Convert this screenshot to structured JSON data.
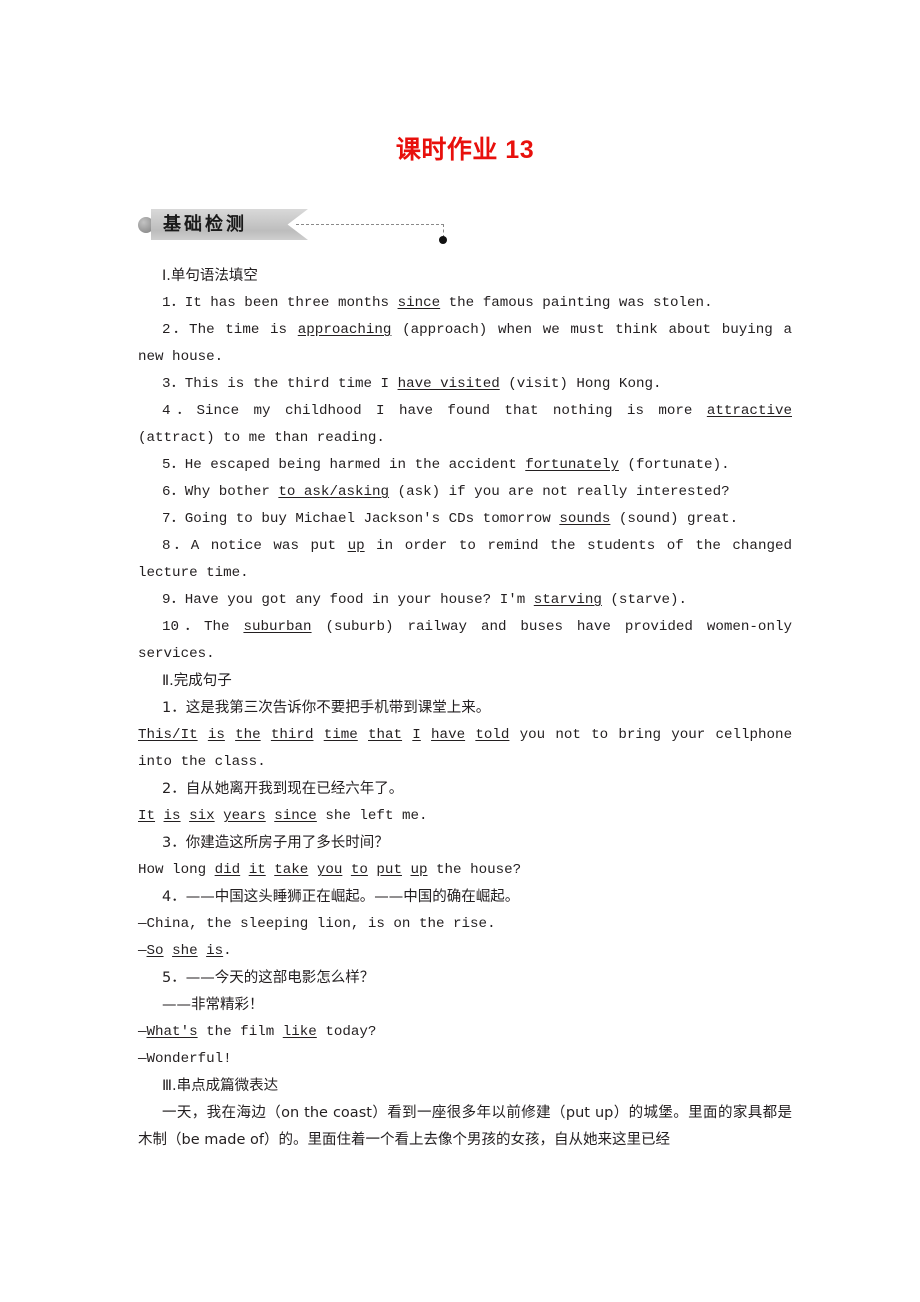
{
  "header": {
    "title": "课时作业 13"
  },
  "banner": {
    "label": "基础检测",
    "ribbon_color": "#c9c9c9",
    "dot_color": "#9c9c9c",
    "end_dot_color": "#111111",
    "dash_color": "#8a8a8a"
  },
  "colors": {
    "title_red": "#e8100c",
    "body_text": "#231f20"
  },
  "sections": [
    {
      "heading": "Ⅰ.单句语法填空",
      "items": [
        "1．It has been three months since the famous painting was stolen.",
        "2．The time is approaching (approach) when we must think about buying a new house.",
        "3．This is the third time I have visited (visit) Hong Kong.",
        "4．Since my childhood I have found that nothing is more attractive (attract) to me than reading.",
        "5．He escaped being harmed in the accident fortunately (fortunate).",
        "6．Why bother to ask/asking (ask) if you are not really interested?",
        "7．Going to buy Michael Jackson's CDs tomorrow sounds (sound) great.",
        "8．A notice was put up in order to remind the students of the changed lecture time.",
        "9．Have you got any food in your house? I'm starving (starve).",
        "10．The suburban (suburb) railway and buses have provided women-only services."
      ],
      "answers": [
        "since",
        "approaching",
        "have visited",
        "attractive",
        "fortunately",
        "to ask/asking",
        "sounds",
        "up",
        "starving",
        "suburban"
      ]
    },
    {
      "heading": "Ⅱ.完成句子",
      "items": [
        {
          "prompt": "1．这是我第三次告诉你不要把手机带到课堂上来。",
          "answer": "This/It is the third time that I have told you not to bring your cellphone into the class."
        },
        {
          "prompt": "2．自从她离开我到现在已经六年了。",
          "answer": "It is six years since she left me."
        },
        {
          "prompt": "3．你建造这所房子用了多长时间？",
          "answer": "How long did it take you to put up the house?"
        },
        {
          "prompt": "4．——中国这头睡狮正在崛起。——中国的确在崛起。",
          "answer": "—China, the sleeping lion, is on the rise.",
          "answer2": "—So she is."
        },
        {
          "prompt": "5．——今天的这部电影怎么样？",
          "prompt2": "——非常精彩！",
          "answer": "—What's the film like today?",
          "answer2": "—Wonderful!"
        }
      ]
    },
    {
      "heading": "Ⅲ.串点成篇微表达",
      "paragraph": "一天，我在海边（on the coast）看到一座很多年以前修建（put up）的城堡。里面的家具都是木制（be made of）的。里面住着一个看上去像个男孩的女孩，自从她来这里已经"
    }
  ],
  "lines": {
    "i_1": "1．It has been three months ",
    "i_1_ans": "since",
    "i_1_b": " the famous painting was stolen.",
    "i_2": "2．The time is ",
    "i_2_ans": "approaching",
    "i_2_b": " (approach) when we must think about buying a new house.",
    "i_3": "3．This is the third time I ",
    "i_3_ans": "have visited",
    "i_3_b": " (visit) Hong Kong.",
    "i_4": "4．Since my childhood I have found that nothing is more ",
    "i_4_ans": "attractive",
    "i_4_b": " (attract) to me than reading.",
    "i_5": "5．He escaped being harmed in the accident ",
    "i_5_ans": "fortunately",
    "i_5_b": " (fortunate).",
    "i_6": "6．Why bother ",
    "i_6_ans": "to ask/asking",
    "i_6_b": " (ask) if you are not really interested?",
    "i_7": "7．Going to buy Michael Jackson's CDs tomorrow ",
    "i_7_ans": "sounds",
    "i_7_b": " (sound) great.",
    "i_8": "8．A notice was put ",
    "i_8_ans": "up",
    "i_8_b": " in order to remind the students of the changed lecture time.",
    "i_9": "9．Have you got any food in your house? I'm ",
    "i_9_ans": "starving",
    "i_9_b": " (starve).",
    "i_10": "10．The ",
    "i_10_ans": "suburban",
    "i_10_b": " (suburb) railway and buses have provided women-only services.",
    "ii_1_cn": "1．这是我第三次告诉你不要把手机带到课堂上来。",
    "ii_1_a1": "This/It",
    "ii_1_a2": "is",
    "ii_1_a3": "the",
    "ii_1_a4": "third",
    "ii_1_a5": "time",
    "ii_1_a6": "that",
    "ii_1_a7": "I",
    "ii_1_a8": "have",
    "ii_1_a9": "told",
    "ii_1_rest": " you not to bring your cellphone into the class.",
    "ii_2_cn": "2．自从她离开我到现在已经六年了。",
    "ii_2_a1": "It",
    "ii_2_a2": "is",
    "ii_2_a3": "six",
    "ii_2_a4": "years",
    "ii_2_a5": "since",
    "ii_2_rest": " she left me.",
    "ii_3_cn": "3．你建造这所房子用了多长时间？",
    "ii_3_pre": "How long ",
    "ii_3_a1": "did",
    "ii_3_a2": "it",
    "ii_3_a3": "take",
    "ii_3_a4": "you",
    "ii_3_a5": "to",
    "ii_3_a6": "put",
    "ii_3_a7": "up",
    "ii_3_rest": " the house?",
    "ii_4_cn": "4．——中国这头睡狮正在崛起。——中国的确在崛起。",
    "ii_4_l1": "—China, the sleeping lion, is on the rise.",
    "ii_4_dash": "—",
    "ii_4_a1": "So",
    "ii_4_a2": "she",
    "ii_4_a3": "is",
    "ii_4_period": ".",
    "ii_5_cn": "5．——今天的这部电影怎么样？",
    "ii_5_cn2": "——非常精彩！",
    "ii_5_dash": "—",
    "ii_5_a1": "What's",
    "ii_5_mid": " the film ",
    "ii_5_a2": "like",
    "ii_5_rest": " today?",
    "ii_5_l2": "—Wonderful!",
    "iii_p": "一天，我在海边（on the coast）看到一座很多年以前修建（put up）的城堡。里面的家具都是木制（be made of）的。里面住着一个看上去像个男孩的女孩，自从她来这里已经"
  }
}
